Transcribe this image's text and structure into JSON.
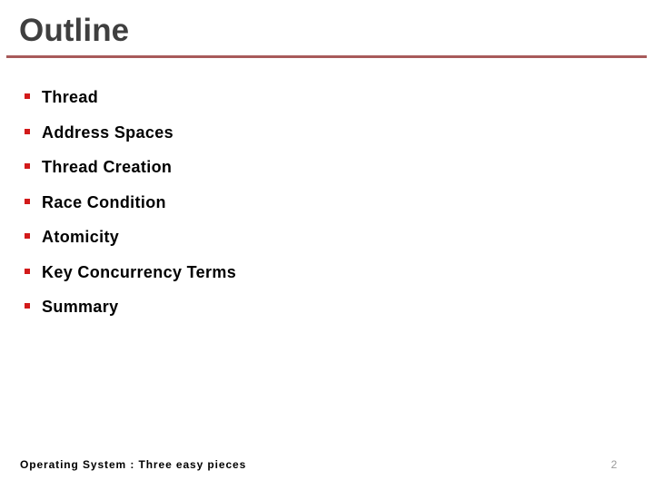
{
  "slide": {
    "title": "Outline",
    "title_color": "#3f3f3f",
    "rule_color": "#a85a5a",
    "background_color": "#ffffff",
    "bullet_marker_color": "#d21a1a",
    "bullet_glyph": "square-bullet-icon",
    "bullets": [
      {
        "label": "Thread"
      },
      {
        "label": "Address Spaces"
      },
      {
        "label": "Thread Creation"
      },
      {
        "label": "Race Condition"
      },
      {
        "label": "Atomicity"
      },
      {
        "label": "Key Concurrency Terms"
      },
      {
        "label": "Summary"
      }
    ],
    "footer": {
      "text": "Operating System : Three easy pieces",
      "page_number": "2",
      "page_number_color": "#9a9a9a"
    }
  }
}
